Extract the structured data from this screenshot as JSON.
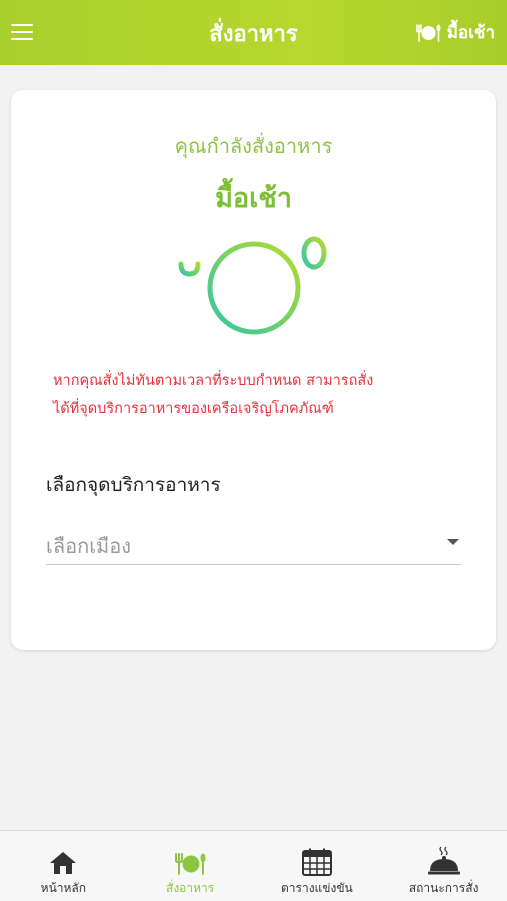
{
  "header": {
    "title": "สั่งอาหาร",
    "meal_label": "มื้อเช้า"
  },
  "card": {
    "ordering_text": "คุณกำลังสั่งอาหาร",
    "meal_name": "มื้อเช้า",
    "warning_line1": "หากคุณสั่งไม่ทันตามเวลาที่ระบบกำหนด สามารถสั่ง",
    "warning_line2": "ได้ที่จุดบริการอาหารของเครือเจริญโภคภัณฑ์",
    "select_label": "เลือกจุดบริการอาหาร",
    "select_placeholder": "เลือกเมือง"
  },
  "bottom_nav": {
    "items": [
      {
        "label": "หน้าหลัก",
        "icon": "home-icon"
      },
      {
        "label": "สั่งอาหาร",
        "icon": "dining-icon",
        "active": true
      },
      {
        "label": "ตารางแข่งขัน",
        "icon": "calendar-icon"
      },
      {
        "label": "สถานะการสั่ง",
        "icon": "food-cloche-icon"
      }
    ]
  },
  "colors": {
    "header_green": "#a9cf2b",
    "accent_green": "#8cc63f",
    "warning_red": "#e8323c"
  }
}
